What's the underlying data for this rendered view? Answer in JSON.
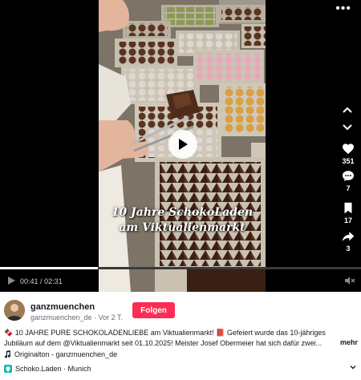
{
  "video": {
    "caption_line1": "10 Jahre SchokoLaden",
    "caption_line2": "am Viktualienmarkt",
    "elapsed": "00:41",
    "duration": "02:31",
    "time_separator": "/",
    "progress_fraction": 0.27
  },
  "actions": {
    "likes": "351",
    "comments": "7",
    "saves": "17",
    "shares": "3"
  },
  "author": {
    "name": "ganzmuenchen",
    "handle": "ganzmuenchen_de",
    "age": "Vor 2 T.",
    "separator": "·"
  },
  "follow_label": "Folgen",
  "description": {
    "text": "🍫 10 JAHRE PURE SCHOKOLADENLIEBE am Viktualienmarkt! 📕 Gefeiert wurde das 10-jähriges Jubiläum auf dem @Viktualienmarkt seit 01.10.2025! Meister Josef Obermeier hat sich dafür zwei...",
    "more_label": "mehr"
  },
  "sound": {
    "icon": "music-note-icon",
    "label": "Originalton - ganzmuenchen_de"
  },
  "place": {
    "icon": "location-icon",
    "label": "Schoko.Laden · Munich"
  },
  "colors": {
    "accent": "#fe2c55",
    "place_icon": "#14b8a6"
  }
}
